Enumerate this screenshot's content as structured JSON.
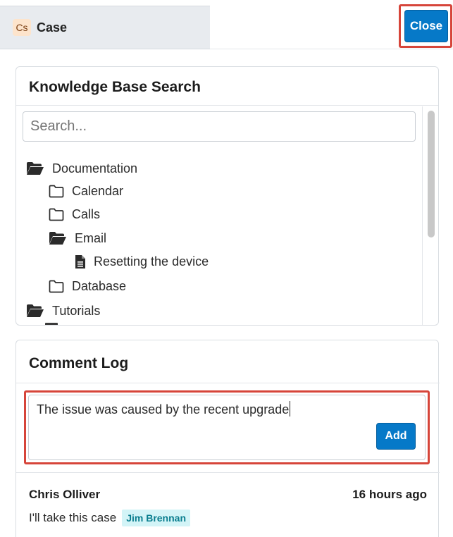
{
  "tabs": {
    "case": {
      "badge": "Cs",
      "title": "Case"
    }
  },
  "header": {
    "close_label": "Close"
  },
  "kb": {
    "title": "Knowledge Base Search",
    "search_placeholder": "Search...",
    "tree": [
      {
        "label": "Documentation",
        "icon": "folder-open-icon"
      },
      {
        "label": "Calendar",
        "icon": "folder-icon"
      },
      {
        "label": "Calls",
        "icon": "folder-icon"
      },
      {
        "label": "Email",
        "icon": "folder-open-icon"
      },
      {
        "label": "Resetting the device",
        "icon": "document-icon"
      },
      {
        "label": "Database",
        "icon": "folder-icon"
      },
      {
        "label": "Tutorials",
        "icon": "folder-open-icon"
      }
    ]
  },
  "comment_log": {
    "title": "Comment Log",
    "draft": "The issue was caused by the recent upgrade",
    "add_label": "Add",
    "entries": [
      {
        "author": "Chris Olliver",
        "time": "16 hours ago",
        "text": "I'll take this case",
        "mention": "Jim Brennan"
      }
    ]
  },
  "colors": {
    "primary_button": "#0679c8",
    "highlight_border": "#d6453a",
    "case_badge_bg": "#fde4cc",
    "mention_bg": "#d3f4f7"
  }
}
